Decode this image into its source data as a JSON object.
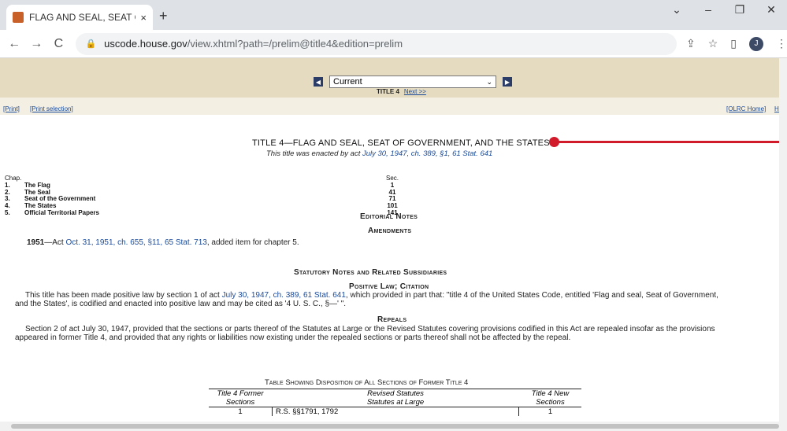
{
  "browser": {
    "tab_title": "FLAG AND SEAL, SEAT OF GOVER",
    "tab_close": "×",
    "new_tab": "+",
    "url_host": "uscode.house.gov",
    "url_path": "/view.xhtml?path=/prelim@title4&edition=prelim",
    "avatar_letter": "J",
    "icons": [
      "back-icon",
      "forward-icon",
      "reload-icon",
      "lock-icon",
      "share-icon",
      "star-icon",
      "sidepanel-icon",
      "menu-icon"
    ]
  },
  "header": {
    "select_value": "Current",
    "title_label": "TITLE 4",
    "next_link": "Next >>",
    "print_link": "[Print]",
    "print_selection_link": "[Print selection]",
    "olrc_home_link": "[OLRC Home]",
    "help_link": "Help"
  },
  "document": {
    "title": "TITLE 4—FLAG AND SEAL, SEAT OF GOVERNMENT, AND THE STATES",
    "subtitle_prefix": "This title was enacted by act ",
    "subtitle_link": "July 30, 1947, ch. 389, §1, 61 Stat. 641",
    "chap_header": "Chap.",
    "sec_header": "Sec.",
    "chapters": [
      {
        "num": "1.",
        "name": "The Flag",
        "sec": "1"
      },
      {
        "num": "2.",
        "name": "The Seal",
        "sec": "41"
      },
      {
        "num": "3.",
        "name": "Seat of the Government",
        "sec": "71"
      },
      {
        "num": "4.",
        "name": "The States",
        "sec": "101"
      },
      {
        "num": "5.",
        "name": "Official Territorial Papers",
        "sec": "141"
      }
    ],
    "editorial_notes": "Editorial Notes",
    "amendments": "Amendments",
    "amend_year": "1951",
    "amend_prefix": "—Act ",
    "amend_link": "Oct. 31, 1951, ch. 655, §11, 65 Stat. 713",
    "amend_suffix": ", added item for chapter 5.",
    "statutory_notes": "Statutory Notes and Related Subsidiaries",
    "positive_law": "Positive Law; Citation",
    "positive_prefix": "This title has been made positive law by section 1 of act ",
    "positive_link": "July 30, 1947, ch. 389, 61 Stat. 641",
    "positive_suffix": ", which provided in part that: \"title 4 of the United States Code, entitled 'Flag and seal, Seat of Government,",
    "positive_line2": "and the States', is codified and enacted into positive law and may be cited as '4 U. S. C., §—' \".",
    "repeals": "Repeals",
    "repeals_line1": "Section 2 of act July 30, 1947, provided that the sections or parts thereof of the Statutes at Large or the Revised Statutes covering provisions codified in this Act are repealed insofar as the provisions",
    "repeals_line2": "appeared in former Title 4, and provided that any rights or liabilities now existing under the repealed sections or parts thereof shall not be affected by the repeal.",
    "table_caption": "Table Showing Disposition of All Sections of Former Title 4",
    "table_head": {
      "c1a": "Title 4 Former",
      "c1b": "Sections",
      "c2a": "Revised Statutes",
      "c2b": "Statutes at Large",
      "c3a": "Title 4 New",
      "c3b": "Sections"
    },
    "table_rows": [
      {
        "former": "1",
        "statutes": "R.S. §§1791, 1792",
        "new": "1"
      }
    ]
  }
}
